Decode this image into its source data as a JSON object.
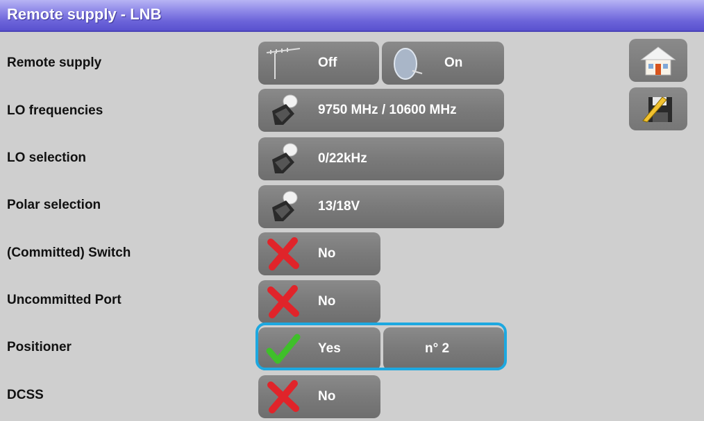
{
  "title": "Remote supply - LNB",
  "rows": [
    {
      "label": "Remote supply",
      "value": "Off",
      "value2": "On"
    },
    {
      "label": "LO frequencies",
      "value": "9750 MHz / 10600 MHz"
    },
    {
      "label": "LO selection",
      "value": "0/22kHz"
    },
    {
      "label": "Polar selection",
      "value": "13/18V"
    },
    {
      "label": "(Committed) Switch",
      "value": "No"
    },
    {
      "label": "Uncommitted Port",
      "value": "No"
    },
    {
      "label": "Positioner",
      "value": "Yes",
      "value2": "n° 2"
    },
    {
      "label": "DCSS",
      "value": "No"
    }
  ],
  "side_icons": [
    "home-icon",
    "save-edit-icon"
  ],
  "colors": {
    "title_bar": "#6b63d9",
    "highlight": "#1da8e0",
    "button": "#7a7a7a",
    "background": "#cfcfcf"
  }
}
